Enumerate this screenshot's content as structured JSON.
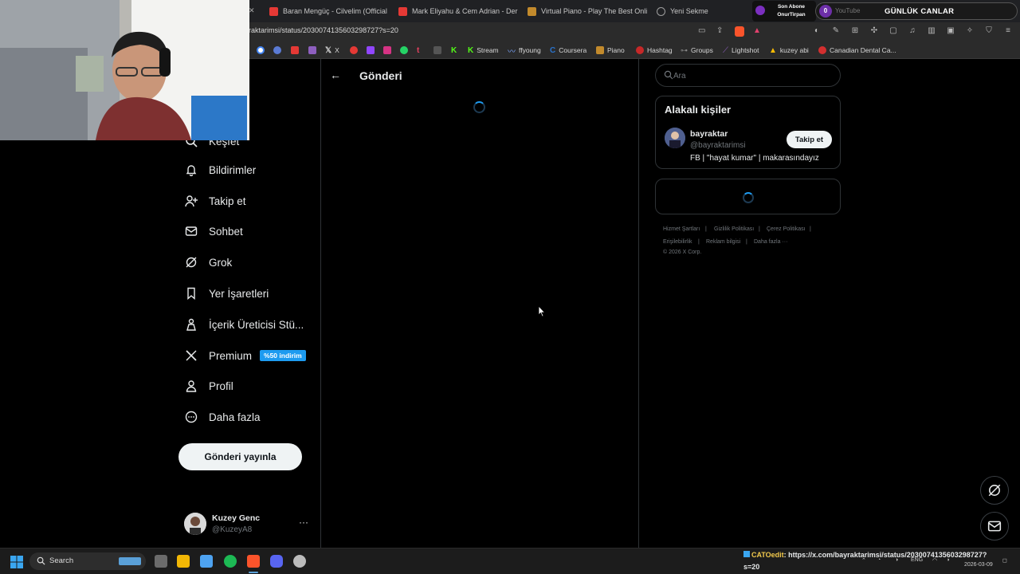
{
  "browser": {
    "tabs": [
      {
        "title": "Baran Mengüç - Cilvelim (Official Vid",
        "icon_color": "#e53935"
      },
      {
        "title": "Mark Eliyahu & Cem Adrian - Derinle",
        "icon_color": "#e53935"
      },
      {
        "title": "Virtual Piano - Play The Best Online P",
        "icon_color": "#c28a2c"
      },
      {
        "title": "Yeni Sekme",
        "icon_color": "#9e9e9e"
      }
    ],
    "url": "raktarimsi/status/2030074135603298727?s=20",
    "bookmarks": [
      {
        "label": "",
        "icon_color": "#4285f4"
      },
      {
        "label": "",
        "icon_color": "#5b7bd5"
      },
      {
        "label": "",
        "icon_color": "#e53935"
      },
      {
        "label": "",
        "icon_color": "#8e5fbf"
      },
      {
        "label": "X",
        "icon_color": "#000000"
      },
      {
        "label": "",
        "icon_color": "#e53935"
      },
      {
        "label": "",
        "icon_color": "#9146ff"
      },
      {
        "label": "",
        "icon_color": "#d63384"
      },
      {
        "label": "",
        "icon_color": "#25d366"
      },
      {
        "label": "",
        "icon_color": "#e4405f"
      },
      {
        "label": "",
        "icon_color": "#555555"
      },
      {
        "label": "",
        "icon_color": "#53fc18"
      },
      {
        "label": "Stream",
        "icon_color": "#53fc18"
      },
      {
        "label": "ffyoung",
        "icon_color": "#7aa7ff"
      },
      {
        "label": "Coursera",
        "icon_color": "#2a73cc"
      },
      {
        "label": "Piano",
        "icon_color": "#c28a2c"
      },
      {
        "label": "Hashtag",
        "icon_color": "#c62828"
      },
      {
        "label": "Groups",
        "icon_color": "#555555"
      },
      {
        "label": "Lightshot",
        "icon_color": "#8e5fbf"
      },
      {
        "label": "kuzey abi",
        "icon_color": "#fbbc04"
      },
      {
        "label": "Canadian Dental Ca...",
        "icon_color": "#d32f2f"
      }
    ]
  },
  "overlay": {
    "sub_label": "Son Abone",
    "sub_name": "OnurTirpan",
    "count": "0",
    "platform": "YouTube",
    "title": "GÜNLÜK CANLAR"
  },
  "sidebar": {
    "partial_item": "Keşfet",
    "items": [
      {
        "label": "Bildirimler",
        "icon": "bell-icon"
      },
      {
        "label": "Takip et",
        "icon": "person-add-icon"
      },
      {
        "label": "Sohbet",
        "icon": "envelope-icon"
      },
      {
        "label": "Grok",
        "icon": "grok-icon"
      },
      {
        "label": "Yer İşaretleri",
        "icon": "bookmark-icon"
      },
      {
        "label": "İçerik Üreticisi Stü...",
        "icon": "creator-icon"
      },
      {
        "label": "Premium",
        "icon": "x-logo-icon",
        "badge": "%50 indirim"
      },
      {
        "label": "Profil",
        "icon": "profile-icon"
      },
      {
        "label": "Daha fazla",
        "icon": "more-circle-icon"
      }
    ],
    "post_button": "Gönderi yayınla",
    "account": {
      "name": "Kuzey Genc",
      "handle": "@KuzeyA8",
      "more": "···"
    }
  },
  "main": {
    "title": "Gönderi",
    "accent": "#1d9bf0"
  },
  "right": {
    "search_placeholder": "Ara",
    "related": {
      "title": "Alakalı kişiler",
      "person": {
        "name": "bayraktar",
        "handle": "@bayraktarimsi",
        "bio": "FB | \"hayat kumar\" | makarasındayız",
        "follow_label": "Takip et"
      }
    },
    "footer": {
      "links": [
        "Hizmet Şartları",
        "|",
        "Gizlilik Politikası",
        "|",
        "Çerez Politikası",
        "|"
      ],
      "links2": [
        "Erişilebilirlik",
        "|",
        "Reklam bilgisi",
        "|",
        "Daha fazla ···"
      ],
      "copyright": "© 2026 X Corp."
    }
  },
  "taskbar": {
    "search_label": "Search",
    "apps": [
      {
        "name": "file-explorer-icon",
        "color": "#f2b705"
      },
      {
        "name": "task-view-icon",
        "color": "#6b6b6b"
      },
      {
        "name": "app-icon",
        "color": "#3a9ad9"
      },
      {
        "name": "photos-icon",
        "color": "#4ea3f1"
      },
      {
        "name": "spotify-icon",
        "color": "#1db954"
      },
      {
        "name": "brave-icon",
        "color": "#fb542b"
      },
      {
        "name": "discord-icon",
        "color": "#5865f2"
      },
      {
        "name": "app2-icon",
        "color": "#bbbbbb"
      }
    ],
    "cato_label": "CATOedit",
    "status_url": ": https://x.com/bayraktarimsi/status/2030074135603298727?",
    "status_url2": "s=20",
    "lang": "ENG",
    "date": "2026-03-09"
  }
}
